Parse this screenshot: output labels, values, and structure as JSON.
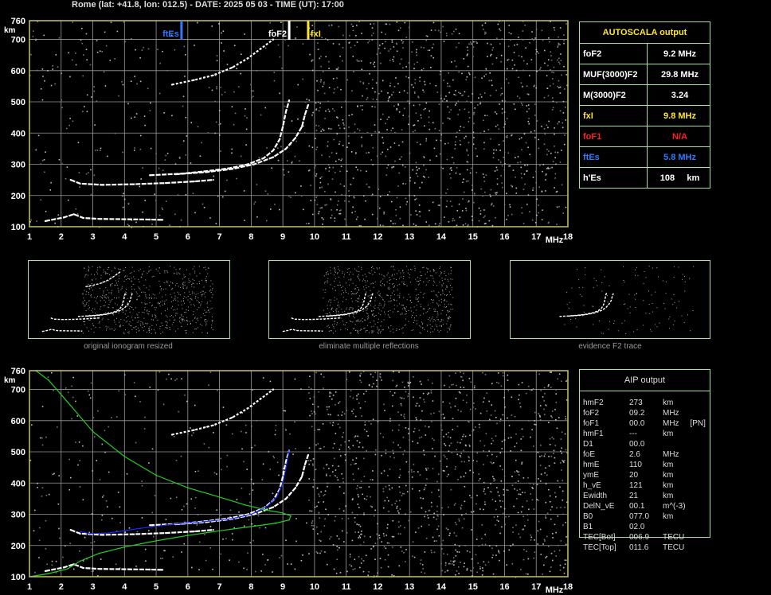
{
  "header": "Rome (lat: +41.8, lon: 012.5) - DATE: 2025 05 03 - TIME (UT): 17:00",
  "colors": {
    "grid": "#9a9a9a",
    "frame": "#c8c46a",
    "ftes": "#2f7bff",
    "yellow": "#ffe629",
    "red": "#ff2020",
    "green": "#22d022",
    "blue": "#1a2aff"
  },
  "chart_data": [
    {
      "type": "scatter",
      "title": "",
      "xlabel": "MHz",
      "ylabel": "km",
      "xlim": [
        1,
        18
      ],
      "ylim": [
        100,
        760
      ],
      "x_ticks": [
        "1",
        "2",
        "3",
        "4",
        "5",
        "6",
        "7",
        "8",
        "9",
        "10",
        "11",
        "12",
        "13",
        "14",
        "15",
        "16",
        "17",
        "18"
      ],
      "y_ticks": [
        "100",
        "200",
        "300",
        "400",
        "500",
        "600",
        "700",
        "760"
      ],
      "grid": true,
      "markers": [
        {
          "label": "ftEs",
          "x": 5.8,
          "color": "#2f7bff"
        },
        {
          "label": "foF2",
          "x": 9.2,
          "color": "#ffffff"
        },
        {
          "label": "fxI",
          "x": 9.8,
          "color": "#ffe629"
        }
      ],
      "series": [
        {
          "trace": "E/Es",
          "points": [
            [
              1.5,
              118
            ],
            [
              1.8,
              124
            ],
            [
              2.1,
              130
            ],
            [
              2.4,
              140
            ],
            [
              2.7,
              128
            ],
            [
              3.2,
              125
            ],
            [
              4,
              124
            ],
            [
              4.8,
              123
            ],
            [
              5.2,
              122
            ]
          ]
        },
        {
          "trace": "F2 ordinary",
          "points": [
            [
              4.8,
              265
            ],
            [
              5.8,
              270
            ],
            [
              6.6,
              278
            ],
            [
              7.3,
              287
            ],
            [
              7.9,
              300
            ],
            [
              8.4,
              320
            ],
            [
              8.7,
              345
            ],
            [
              8.9,
              380
            ],
            [
              9.0,
              420
            ],
            [
              9.1,
              470
            ],
            [
              9.2,
              505
            ]
          ]
        },
        {
          "trace": "F2 extraordinary",
          "points": [
            [
              5.6,
              268
            ],
            [
              6.6,
              275
            ],
            [
              7.4,
              285
            ],
            [
              8.1,
              300
            ],
            [
              8.7,
              323
            ],
            [
              9.1,
              350
            ],
            [
              9.4,
              385
            ],
            [
              9.6,
              420
            ],
            [
              9.7,
              460
            ],
            [
              9.8,
              490
            ]
          ]
        },
        {
          "trace": "F lower",
          "points": [
            [
              2.3,
              250
            ],
            [
              2.6,
              238
            ],
            [
              3.3,
              234
            ],
            [
              4.3,
              236
            ],
            [
              5.3,
              240
            ],
            [
              6.2,
              245
            ],
            [
              6.8,
              250
            ]
          ]
        },
        {
          "trace": "F2 multiple",
          "points": [
            [
              5.5,
              555
            ],
            [
              6.2,
              570
            ],
            [
              6.8,
              585
            ],
            [
              7.4,
              610
            ],
            [
              7.9,
              640
            ],
            [
              8.3,
              670
            ],
            [
              8.7,
              700
            ]
          ]
        }
      ]
    },
    {
      "type": "scatter",
      "title": "",
      "xlabel": "MHz",
      "ylabel": "km",
      "xlim": [
        1,
        18
      ],
      "ylim": [
        100,
        760
      ],
      "x_ticks": [
        "1",
        "2",
        "3",
        "4",
        "5",
        "6",
        "7",
        "8",
        "9",
        "10",
        "11",
        "12",
        "13",
        "14",
        "15",
        "16",
        "17",
        "18"
      ],
      "y_ticks": [
        "100",
        "200",
        "300",
        "400",
        "500",
        "600",
        "700",
        "760"
      ],
      "grid": true,
      "series": [
        {
          "trace": "E/Es",
          "points": [
            [
              1.5,
              118
            ],
            [
              1.8,
              124
            ],
            [
              2.1,
              130
            ],
            [
              2.4,
              140
            ],
            [
              2.7,
              128
            ],
            [
              3.2,
              125
            ],
            [
              4,
              124
            ],
            [
              4.8,
              123
            ],
            [
              5.2,
              122
            ]
          ]
        },
        {
          "trace": "F2 ordinary",
          "points": [
            [
              4.8,
              265
            ],
            [
              5.8,
              270
            ],
            [
              6.6,
              278
            ],
            [
              7.3,
              287
            ],
            [
              7.9,
              300
            ],
            [
              8.4,
              320
            ],
            [
              8.7,
              345
            ],
            [
              8.9,
              380
            ],
            [
              9.0,
              420
            ],
            [
              9.1,
              470
            ],
            [
              9.2,
              505
            ]
          ]
        },
        {
          "trace": "F2 extraordinary",
          "points": [
            [
              5.6,
              268
            ],
            [
              6.6,
              275
            ],
            [
              7.4,
              285
            ],
            [
              8.1,
              300
            ],
            [
              8.7,
              323
            ],
            [
              9.1,
              350
            ],
            [
              9.4,
              385
            ],
            [
              9.6,
              420
            ],
            [
              9.7,
              460
            ],
            [
              9.8,
              490
            ]
          ]
        },
        {
          "trace": "F lower",
          "points": [
            [
              2.3,
              250
            ],
            [
              2.6,
              238
            ],
            [
              3.3,
              234
            ],
            [
              4.3,
              236
            ],
            [
              5.3,
              240
            ],
            [
              6.2,
              245
            ],
            [
              6.8,
              250
            ]
          ]
        },
        {
          "trace": "F2 multiple",
          "points": [
            [
              5.5,
              555
            ],
            [
              6.2,
              570
            ],
            [
              6.8,
              585
            ],
            [
              7.4,
              610
            ],
            [
              7.9,
              640
            ],
            [
              8.3,
              670
            ],
            [
              8.7,
              700
            ]
          ]
        },
        {
          "trace": "AIP fitted trace",
          "color": "#1a2aff",
          "points": [
            [
              2.6,
              245
            ],
            [
              2.9,
              238
            ],
            [
              3.5,
              240
            ],
            [
              4.5,
              255
            ],
            [
              5.5,
              268
            ],
            [
              6.5,
              276
            ],
            [
              7.4,
              286
            ],
            [
              8.0,
              300
            ],
            [
              8.5,
              325
            ],
            [
              8.8,
              355
            ],
            [
              9.0,
              400
            ],
            [
              9.1,
              450
            ],
            [
              9.2,
              505
            ]
          ]
        },
        {
          "trace": "AIP vertical profile",
          "color": "#22d022",
          "points": [
            [
              1.0,
              100
            ],
            [
              1.6,
              110
            ],
            [
              2.2,
              125
            ],
            [
              2.6,
              150
            ],
            [
              3.2,
              175
            ],
            [
              4.0,
              195
            ],
            [
              5.0,
              215
            ],
            [
              6.0,
              232
            ],
            [
              7.0,
              247
            ],
            [
              7.8,
              258
            ],
            [
              8.4,
              266
            ],
            [
              8.8,
              272
            ],
            [
              9.2,
              282
            ],
            [
              9.25,
              295
            ],
            [
              9.0,
              304
            ],
            [
              8.5,
              313
            ],
            [
              7.8,
              330
            ],
            [
              7.0,
              355
            ],
            [
              6.0,
              385
            ],
            [
              5.0,
              425
            ],
            [
              4.0,
              485
            ],
            [
              3.0,
              565
            ],
            [
              2.2,
              660
            ],
            [
              1.6,
              730
            ],
            [
              1.2,
              760
            ]
          ]
        }
      ]
    }
  ],
  "thumbnails": [
    {
      "caption": "original ionogram resized"
    },
    {
      "caption": "eliminate multiple reflections"
    },
    {
      "caption": "evidence F2 trace"
    }
  ],
  "autoscala": {
    "title": "AUTOSCALA output",
    "rows": [
      {
        "label": "foF2",
        "value": "9.2 MHz",
        "color": "#ffffff"
      },
      {
        "label": "MUF(3000)F2",
        "value": "29.8 MHz",
        "color": "#ffffff"
      },
      {
        "label": "M(3000)F2",
        "value": "3.24",
        "color": "#ffffff"
      },
      {
        "label": "fxI",
        "value": "9.8 MHz",
        "color": "#ffe629"
      },
      {
        "label": "foF1",
        "value": "N/A",
        "color": "#ff2020"
      },
      {
        "label": "ftEs",
        "value": "5.8 MHz",
        "color": "#2f7bff"
      },
      {
        "label": "h'Es",
        "value": "108     km",
        "color": "#ffffff"
      }
    ]
  },
  "aip": {
    "title": "AIP output",
    "rows": [
      {
        "name": "hmF2",
        "value": "273",
        "unit": "km"
      },
      {
        "name": "foF2",
        "value": "09.2",
        "unit": "MHz"
      },
      {
        "name": "foF1",
        "value": "00.0",
        "unit": "MHz     [PN]"
      },
      {
        "name": "hmF1",
        "value": "---",
        "unit": "km"
      },
      {
        "name": "D1",
        "value": "00.0",
        "unit": ""
      },
      {
        "name": "foE",
        "value": "2.6",
        "unit": "MHz"
      },
      {
        "name": "hmE",
        "value": "110",
        "unit": "km"
      },
      {
        "name": "ymE",
        "value": "20",
        "unit": "km"
      },
      {
        "name": "h_vE",
        "value": "121",
        "unit": "km"
      },
      {
        "name": "Ewidth",
        "value": "21",
        "unit": "km"
      },
      {
        "name": "DelN_vE",
        "value": "00.1",
        "unit": "m^(-3)"
      },
      {
        "name": "B0",
        "value": "077.0",
        "unit": "km"
      },
      {
        "name": "B1",
        "value": "02.0",
        "unit": ""
      },
      {
        "name": "TEC[Bot]",
        "value": "006.9",
        "unit": "TECU"
      },
      {
        "name": "TEC[Top]",
        "value": "011.6",
        "unit": "TECU"
      }
    ]
  }
}
